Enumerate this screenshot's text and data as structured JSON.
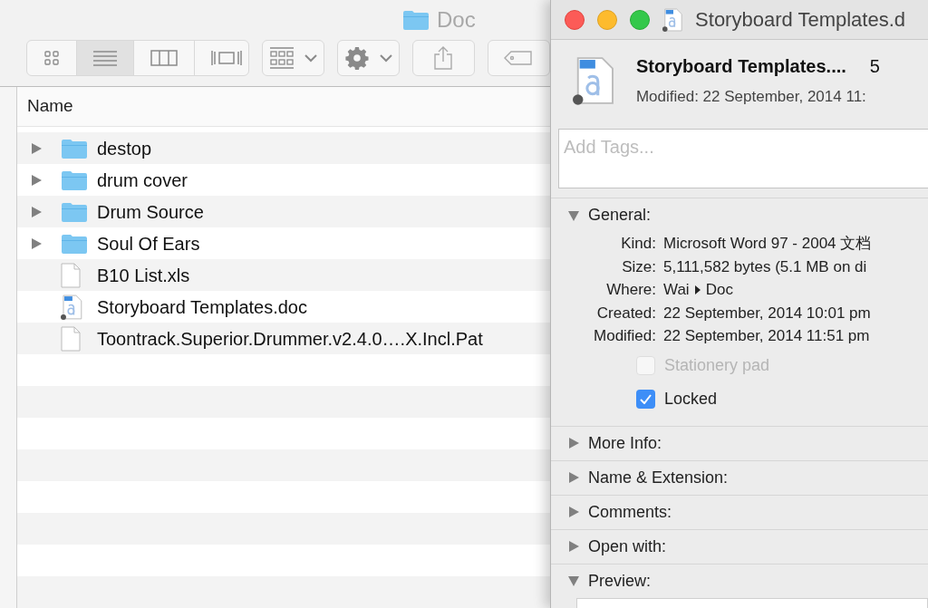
{
  "finder": {
    "title": "Doc",
    "view_buttons": [
      {
        "kind": "icons",
        "selected": false
      },
      {
        "kind": "list",
        "selected": true
      },
      {
        "kind": "columns",
        "selected": false
      },
      {
        "kind": "coverflow",
        "selected": false
      }
    ],
    "column_header": "Name",
    "rows": [
      {
        "name": "destop",
        "kind": "folder",
        "expanded": false
      },
      {
        "name": "drum cover",
        "kind": "folder",
        "expanded": false
      },
      {
        "name": "Drum Source",
        "kind": "folder",
        "expanded": false
      },
      {
        "name": "Soul Of Ears",
        "kind": "folder",
        "expanded": false
      },
      {
        "name": "B10 List.xls",
        "kind": "file"
      },
      {
        "name": "Storyboard Templates.doc",
        "kind": "doc"
      },
      {
        "name": "Toontrack.Superior.Drummer.v2.4.0….X.Incl.Pat",
        "kind": "file"
      }
    ]
  },
  "info": {
    "title": "Storyboard Templates.d",
    "name": "Storyboard Templates....",
    "size": "5",
    "modified": "Modified: 22 September, 2014 11:",
    "tags": {
      "placeholder": "Add Tags..."
    },
    "general": {
      "label": "General:",
      "expanded": true,
      "fields": [
        {
          "label": "Kind:",
          "value": "Microsoft Word 97 - 2004 文档"
        },
        {
          "label": "Size:",
          "value": "5,111,582 bytes (5.1 MB on di"
        },
        {
          "label": "Where:",
          "path": [
            "Wai",
            "Doc"
          ]
        },
        {
          "label": "Created:",
          "value": "22 September, 2014 10:01 pm"
        },
        {
          "label": "Modified:",
          "value": "22 September, 2014 11:51 pm"
        }
      ],
      "checkboxes": [
        {
          "label": "Stationery pad",
          "checked": false,
          "disabled": true
        },
        {
          "label": "Locked",
          "checked": true,
          "disabled": false
        }
      ]
    },
    "sections": [
      {
        "label": "More Info:",
        "expanded": false
      },
      {
        "label": "Name & Extension:",
        "expanded": false
      },
      {
        "label": "Comments:",
        "expanded": false
      },
      {
        "label": "Open with:",
        "expanded": false
      },
      {
        "label": "Preview:",
        "expanded": true
      }
    ]
  }
}
